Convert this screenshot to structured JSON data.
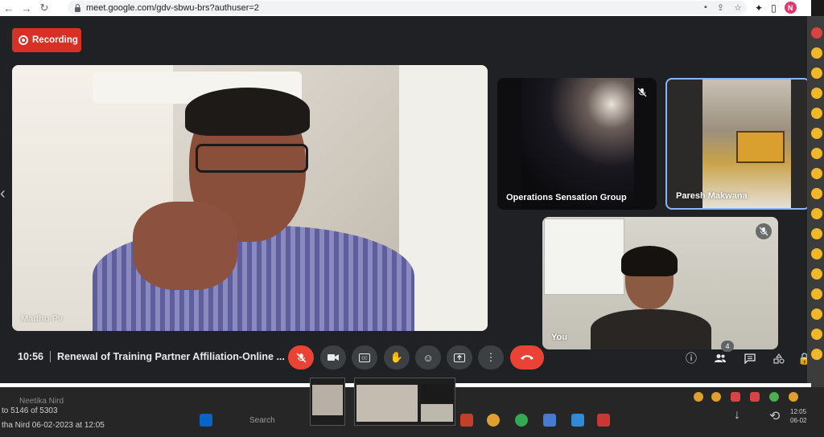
{
  "browser": {
    "url": "meet.google.com/gdv-sbwu-brs?authuser=2",
    "profile_initial": "N"
  },
  "meet": {
    "recording_label": "Recording",
    "time": "10:56",
    "meeting_title": "Renewal of Training Partner Affiliation-Online ...",
    "participants_count": "4",
    "tiles": {
      "main_name": "Madhu Pv",
      "ops_name": "Operations Sensation Group",
      "paresh_name": "Paresh Makwana",
      "you_name": "You"
    },
    "colors": {
      "end_call": "#ea4335",
      "recording": "#d93025",
      "active_border": "#8ab4f8"
    }
  },
  "desktop": {
    "email_count": "to 5146 of 5303",
    "sender_date": "tha Nird    06-02-2023 at 12:05",
    "sender_top": "Neetika Nird",
    "search_placeholder": "Search",
    "clock_time": "12:05",
    "clock_date": "06-02"
  }
}
